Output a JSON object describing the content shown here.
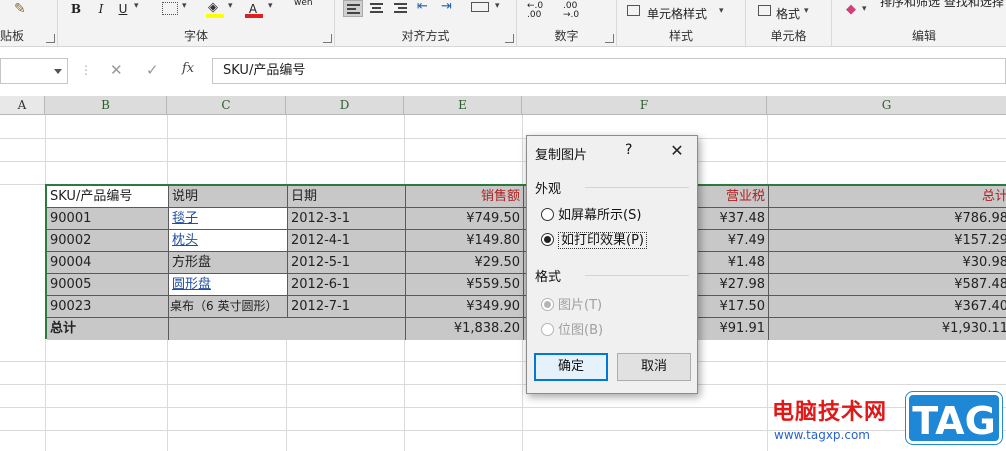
{
  "ribbon": {
    "group_clipboard": "贴板",
    "group_font": "字体",
    "group_align": "对齐方式",
    "group_number": "数字",
    "group_style": "样式",
    "group_cells": "单元格",
    "group_edit": "编辑",
    "bold_label": "B",
    "italic_label": "I",
    "underline_label": "U",
    "font_color_label": "A",
    "phonetic_label": "wén",
    "cell_style_label": "单元格样式",
    "format_label": "格式",
    "sort_filter_label": "排序和筛选 查找和选择"
  },
  "formula_bar": {
    "fx_label": "fx",
    "content": "SKU/产品编号"
  },
  "columns": [
    "A",
    "B",
    "C",
    "D",
    "E",
    "F",
    "G"
  ],
  "table": {
    "headers": [
      "SKU/产品编号",
      "说明",
      "日期",
      "销售额",
      "营业税",
      "总计"
    ],
    "rows": [
      {
        "sku": "90001",
        "desc": "毯子",
        "date": "2012-3-1",
        "sales": "¥749.50",
        "tax": "¥37.48",
        "total": "¥786.98"
      },
      {
        "sku": "90002",
        "desc": "枕头",
        "date": "2012-4-1",
        "sales": "¥149.80",
        "tax": "¥7.49",
        "total": "¥157.29"
      },
      {
        "sku": "90004",
        "desc": "方形盘",
        "date": "2012-5-1",
        "sales": "¥29.50",
        "tax": "¥1.48",
        "total": "¥30.98"
      },
      {
        "sku": "90005",
        "desc": "圆形盘",
        "date": "2012-6-1",
        "sales": "¥559.50",
        "tax": "¥27.98",
        "total": "¥587.48"
      },
      {
        "sku": "90023",
        "desc": "桌布（6 英寸圆形）",
        "date": "2012-7-1",
        "sales": "¥349.90",
        "tax": "¥17.50",
        "total": "¥367.40"
      }
    ],
    "total_row": {
      "label": "总计",
      "sales": "¥1,838.20",
      "tax": "¥91.91",
      "total": "¥1,930.11"
    }
  },
  "dialog": {
    "title": "复制图片",
    "help": "?",
    "close": "✕",
    "appearance_group": "外观",
    "opt_screen": "如屏幕所示(S)",
    "opt_print": "如打印效果(P)",
    "format_group": "格式",
    "opt_picture": "图片(T)",
    "opt_bitmap": "位图(B)",
    "ok_label": "确定",
    "cancel_label": "取消"
  },
  "watermark": {
    "site_name": "电脑技术网",
    "url": "www.tagxp.com",
    "tag": "TAG"
  },
  "colors": {
    "accent_green": "#2c7a3f",
    "header_red": "#b02020",
    "link_blue": "#1f4fa3",
    "dialog_focus": "#0078d7"
  }
}
